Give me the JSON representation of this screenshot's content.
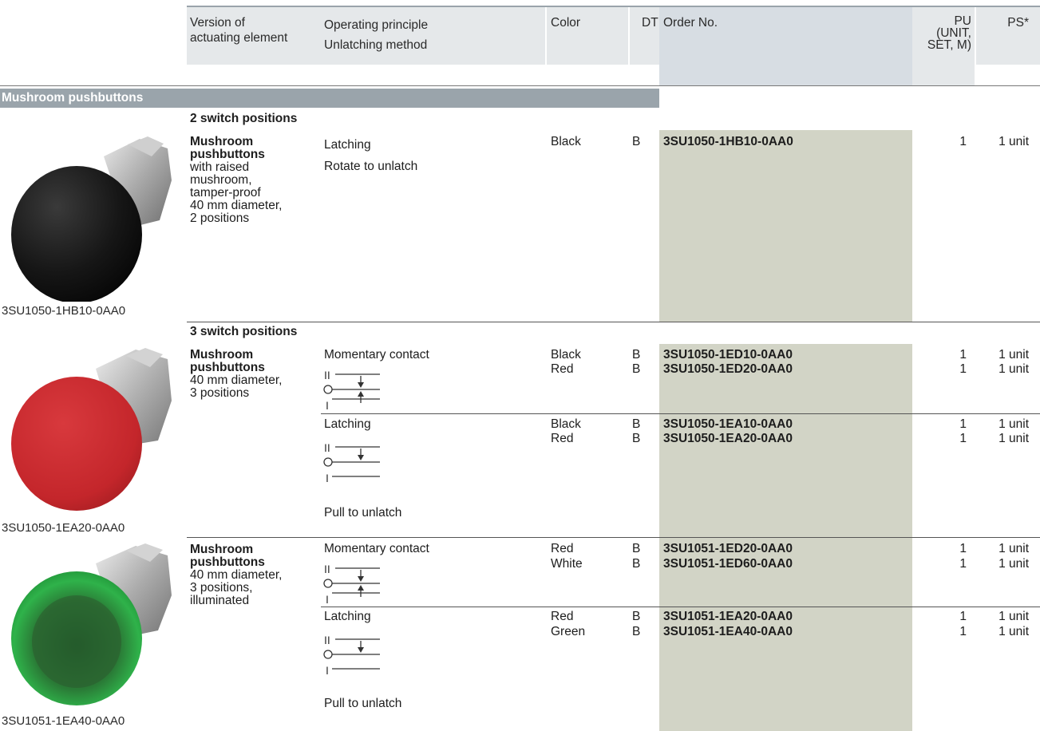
{
  "header": {
    "version_line1": "Version of",
    "version_line2": "actuating element",
    "op_line1": "Operating principle",
    "op_line2": "Unlatching method",
    "color": "Color",
    "dt": "DT",
    "order_no": "Order No.",
    "pu_line1": "PU",
    "pu_line2": "(UNIT,",
    "pu_line3": "SET, M)",
    "ps": "PS*"
  },
  "section_title": "Mushroom pushbuttons",
  "colors": {
    "header_bg": "#e5e8ea",
    "order_col_bg": "#d2d4c6",
    "section_bar": "#9aa4ab",
    "button_black": "#141414",
    "button_red": "#c6262b",
    "button_green": "#1f9e3a"
  },
  "group1": {
    "title": "2 switch positions",
    "desc_bold1": "Mushroom",
    "desc_bold2": "pushbuttons",
    "desc_lines": [
      "with raised",
      "mushroom,",
      "tamper-proof",
      "40 mm diameter,",
      "2 positions"
    ],
    "op1": "Latching",
    "op2": "Rotate to unlatch",
    "row": {
      "color": "Black",
      "dt": "B",
      "order": "3SU1050-1HB10-0AA0",
      "pu": "1",
      "ps": "1 unit"
    },
    "image_caption": "3SU1050-1HB10-0AA0"
  },
  "group2": {
    "title": "3 switch positions",
    "desc_bold1": "Mushroom",
    "desc_bold2": "pushbuttons",
    "desc_lines": [
      "40 mm diameter,",
      "3 positions"
    ],
    "sub1": {
      "op": "Momentary contact",
      "rows": [
        {
          "color": "Black",
          "dt": "B",
          "order": "3SU1050-1ED10-0AA0",
          "pu": "1",
          "ps": "1 unit"
        },
        {
          "color": "Red",
          "dt": "B",
          "order": "3SU1050-1ED20-0AA0",
          "pu": "1",
          "ps": "1 unit"
        }
      ]
    },
    "sub2": {
      "op": "Latching",
      "unlatch": "Pull to unlatch",
      "rows": [
        {
          "color": "Black",
          "dt": "B",
          "order": "3SU1050-1EA10-0AA0",
          "pu": "1",
          "ps": "1 unit"
        },
        {
          "color": "Red",
          "dt": "B",
          "order": "3SU1050-1EA20-0AA0",
          "pu": "1",
          "ps": "1 unit"
        }
      ]
    },
    "image_caption": "3SU1050-1EA20-0AA0"
  },
  "group3": {
    "desc_bold1": "Mushroom",
    "desc_bold2": "pushbuttons",
    "desc_lines": [
      "40 mm diameter,",
      "3 positions,",
      "illuminated"
    ],
    "sub1": {
      "op": "Momentary contact",
      "rows": [
        {
          "color": "Red",
          "dt": "B",
          "order": "3SU1051-1ED20-0AA0",
          "pu": "1",
          "ps": "1 unit"
        },
        {
          "color": "White",
          "dt": "B",
          "order": "3SU1051-1ED60-0AA0",
          "pu": "1",
          "ps": "1 unit"
        }
      ]
    },
    "sub2": {
      "op": "Latching",
      "unlatch": "Pull to unlatch",
      "rows": [
        {
          "color": "Red",
          "dt": "B",
          "order": "3SU1051-1EA20-0AA0",
          "pu": "1",
          "ps": "1 unit"
        },
        {
          "color": "Green",
          "dt": "B",
          "order": "3SU1051-1EA40-0AA0",
          "pu": "1",
          "ps": "1 unit"
        }
      ]
    },
    "image_caption": "3SU1051-1EA40-0AA0"
  },
  "symbols": {
    "pos_top": "II",
    "pos_bottom": "I"
  }
}
